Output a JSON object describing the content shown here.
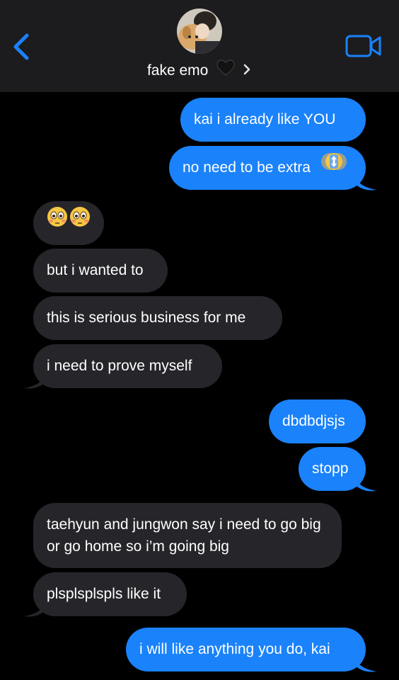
{
  "header": {
    "contact_name": "fake emo",
    "back_icon": "chevron-left-icon",
    "video_icon": "video-camera-icon",
    "accent_color": "#1a82fb"
  },
  "messages": [
    {
      "from": "me",
      "text": "kai i already like YOU"
    },
    {
      "from": "me",
      "text": "no need to be extra"
    },
    {
      "from": "them",
      "text": "",
      "emoji": "flushed-face-emoji-x2"
    },
    {
      "from": "them",
      "text": "but i wanted to"
    },
    {
      "from": "them",
      "text": "this is serious business for me"
    },
    {
      "from": "them",
      "text": "i need to prove myself"
    },
    {
      "from": "me",
      "text": "dbdbdjsjs"
    },
    {
      "from": "me",
      "text": "stopp"
    },
    {
      "from": "them",
      "text": "taehyun and jungwon say i need to go big or go home so i’m going big"
    },
    {
      "from": "them",
      "text": "plsplsplspls like it"
    },
    {
      "from": "me",
      "text": "i will like anything you do, kai"
    }
  ],
  "colors": {
    "sent_bubble": "#1a82fb",
    "received_bubble": "#26252a",
    "background": "#000000"
  }
}
